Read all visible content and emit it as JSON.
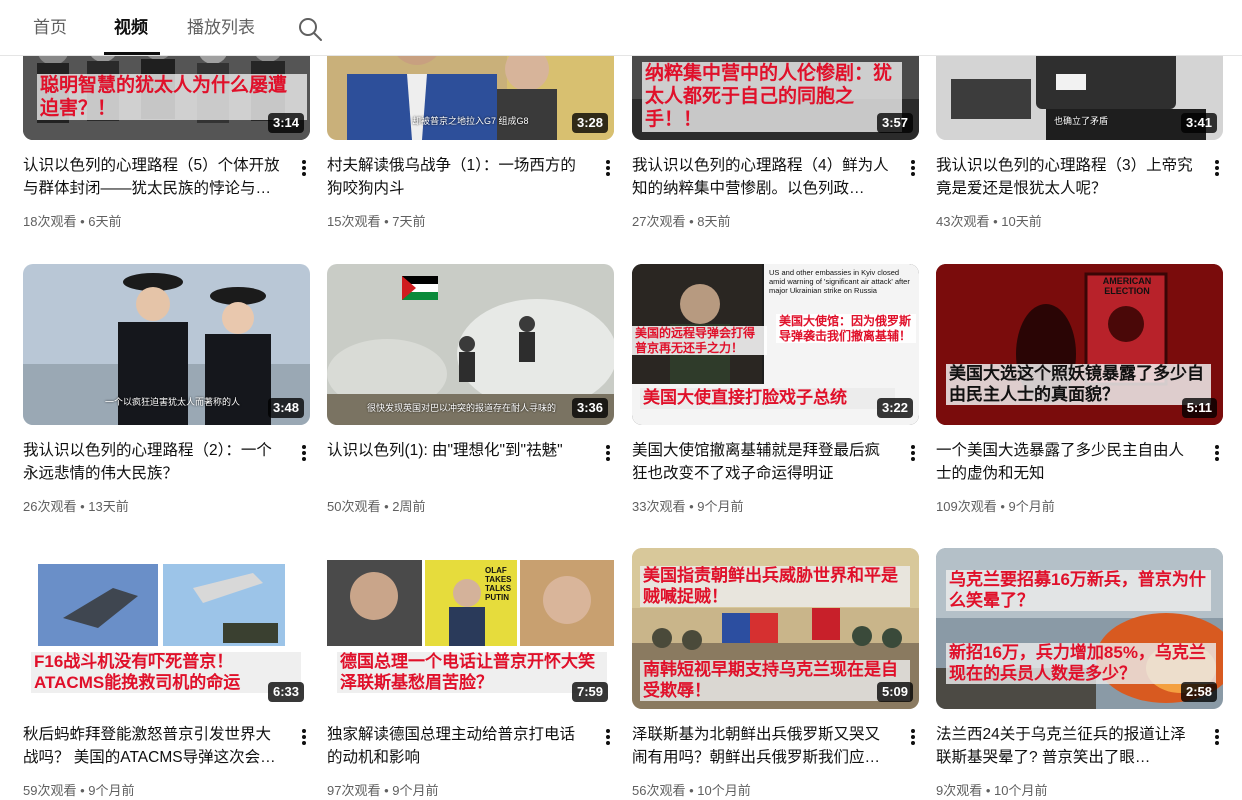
{
  "tabs": [
    {
      "label": "首页",
      "active": false
    },
    {
      "label": "视频",
      "active": true
    },
    {
      "label": "播放列表",
      "active": false
    }
  ],
  "search_icon": "search-icon",
  "views_suffix": "次观看",
  "videos": [
    {
      "title": "认识以色列的心理路程（5）个体开放与群体封闭——犹太民族的悖论与…",
      "views": "18次观看",
      "age": "6天前",
      "duration": "3:14",
      "overlay": "聪明智慧的犹太人为什么屡遭迫害？！",
      "caption": ""
    },
    {
      "title": "村夫解读俄乌战争（1）：一场西方的狗咬狗内斗",
      "views": "15次观看",
      "age": "7天前",
      "duration": "3:28",
      "overlay": "",
      "caption": "却被普京之地拉入G7 组成G8"
    },
    {
      "title": "我认识以色列的心理路程（4）鲜为人知的纳粹集中营惨剧。以色列政…",
      "views": "27次观看",
      "age": "8天前",
      "duration": "3:57",
      "overlay": "纳粹集中营中的人伦惨剧：犹太人都死于自己的同胞之手！！",
      "caption": ""
    },
    {
      "title": "我认识以色列的心理路程（3）上帝究竟是爱还是恨犹太人呢？",
      "views": "43次观看",
      "age": "10天前",
      "duration": "3:41",
      "overlay": "",
      "caption": "也确立了矛盾"
    },
    {
      "title": "我认识以色列的心理路程（2）：一个永远悲情的伟大民族？",
      "views": "26次观看",
      "age": "13天前",
      "duration": "3:48",
      "overlay": "",
      "caption": "一个以疯狂迫害犹太人而著称的人"
    },
    {
      "title": "认识以色列(1): 由\"理想化\"到\"祛魅\"",
      "views": "50次观看",
      "age": "2周前",
      "duration": "3:36",
      "overlay": "",
      "caption": "很快发现英国对巴以冲突的报道存在耐人寻味的"
    },
    {
      "title": "美国大使馆撤离基辅就是拜登最后疯狂也改变不了戏子命运得明证",
      "views": "33次观看",
      "age": "9个月前",
      "duration": "3:22",
      "overlay": "美国大使直接打脸戏子总统",
      "overlay2": "美国的远程导弹会打得普京再无还手之力！",
      "overlay3": "美国大使馆：因为俄罗斯导弹袭击我们撤离基辅！",
      "caption": "US and other embassies in Kyiv closed amid warning of 'significant air attack' after major Ukrainian strike on Russia"
    },
    {
      "title": "一个美国大选暴露了多少民主自由人士的虚伪和无知",
      "views": "109次观看",
      "age": "9个月前",
      "duration": "5:11",
      "overlay": "美国大选这个照妖镜暴露了多少自由民主人士的真面貌？",
      "caption": "AMERICAN ELECTION"
    },
    {
      "title": "秋后蚂蚱拜登能激怒普京引发世界大战吗？ 美国的ATACMS导弹这次会…",
      "views": "59次观看",
      "age": "9个月前",
      "duration": "6:33",
      "overlay": "F16战斗机没有吓死普京！ATACMS能挽救司机的命运",
      "caption": ""
    },
    {
      "title": "独家解读德国总理主动给普京打电话的动机和影响",
      "views": "97次观看",
      "age": "9个月前",
      "duration": "7:59",
      "overlay": "德国总理一个电话让普京开怀大笑泽联斯基愁眉苦脸？",
      "caption": "OLAF TAKES TALKS PUTIN"
    },
    {
      "title": "泽联斯基为北朝鲜出兵俄罗斯又哭又闹有用吗？朝鲜出兵俄罗斯我们应…",
      "views": "56次观看",
      "age": "10个月前",
      "duration": "5:09",
      "overlay": "美国指责朝鲜出兵威胁世界和平是贼喊捉贼！",
      "overlay2": "南韩短视早期支持乌克兰现在是自受欺辱！",
      "caption": ""
    },
    {
      "title": "法兰西24关于乌克兰征兵的报道让泽联斯基哭晕了? 普京笑出了眼…",
      "views": "9次观看",
      "age": "10个月前",
      "duration": "2:58",
      "overlay": "乌克兰要招募16万新兵，普京为什么笑晕了？",
      "overlay2": "新招16万，兵力增加85%，乌克兰现在的兵员人数是多少？",
      "caption": ""
    }
  ]
}
